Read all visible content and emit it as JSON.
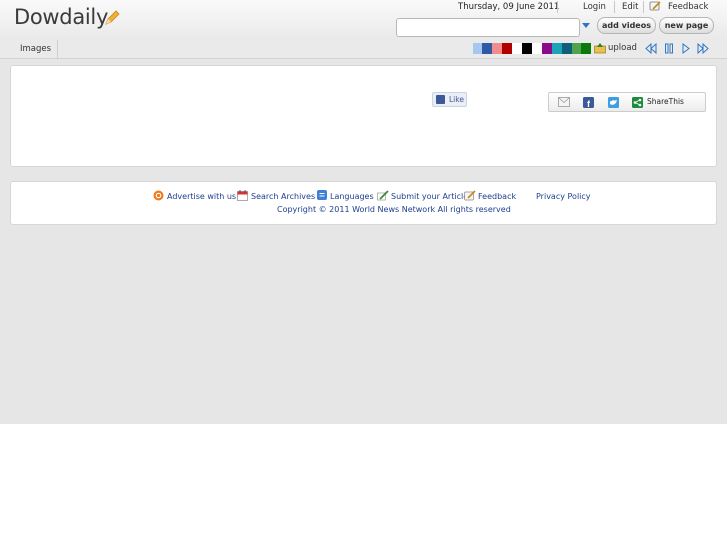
{
  "header": {
    "logo": "Dowdaily",
    "date": "Thursday, 09 June 2011",
    "nav": {
      "login": "Login",
      "edit": "Edit",
      "feedback": "Feedback"
    },
    "search": {
      "value": "",
      "placeholder": ""
    },
    "add_videos": "add videos",
    "new_page": "new page"
  },
  "toolbar": {
    "tab_images": "Images",
    "upload": "upload",
    "swatches": [
      "#a7c7ee",
      "#2f5aa6",
      "#f08c8c",
      "#b00000",
      "#ffffff",
      "#000000",
      "#ffffff",
      "#8a0a8a",
      "#1ba3b8",
      "#0e5f7a",
      "#4fa24f",
      "#0a7a0a"
    ]
  },
  "content": {
    "like": "Like",
    "sharethis": "ShareThis"
  },
  "footer": {
    "advertise": "Advertise with us!",
    "search_archives": "Search Archives",
    "languages": "Languages",
    "submit_article": "Submit your Article",
    "feedback": "Feedback",
    "privacy": "Privacy Policy",
    "copyright": "Copyright © 2011 World News Network All rights reserved"
  },
  "colors": {
    "link": "#1d3f8f",
    "accent": "#2f77c6",
    "page_bg": "#e6e6e6"
  }
}
